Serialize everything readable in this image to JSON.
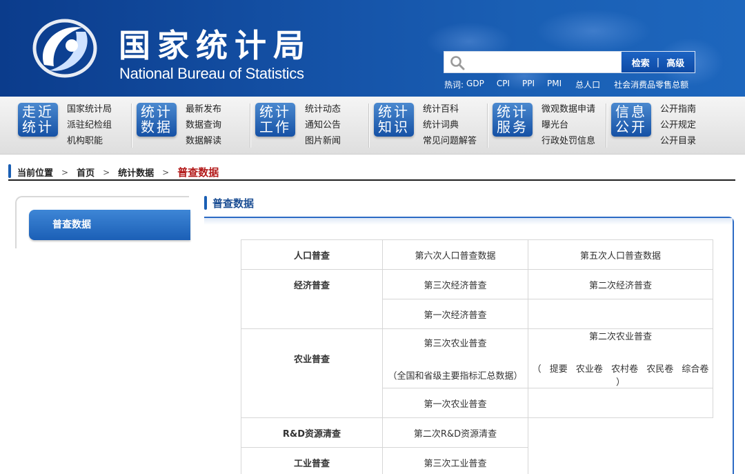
{
  "header": {
    "logo_cn": "国家统计局",
    "logo_en": "National Bureau of Statistics",
    "search_placeholder": "",
    "search_button": "检索",
    "advanced_button": "高级",
    "hotwords_label": "热词:",
    "hotwords": [
      "GDP",
      "CPI",
      "PPI",
      "PMI",
      "总人口",
      "社会消费品零售总额"
    ]
  },
  "nav": [
    {
      "badge": [
        "走近",
        "统计"
      ],
      "links": [
        "国家统计局",
        "派驻纪检组",
        "机构职能"
      ]
    },
    {
      "badge": [
        "统计",
        "数据"
      ],
      "links": [
        "最新发布",
        "数据查询",
        "数据解读"
      ]
    },
    {
      "badge": [
        "统计",
        "工作"
      ],
      "links": [
        "统计动态",
        "通知公告",
        "图片新闻"
      ]
    },
    {
      "badge": [
        "统计",
        "知识"
      ],
      "links": [
        "统计百科",
        "统计词典",
        "常见问题解答"
      ]
    },
    {
      "badge": [
        "统计",
        "服务"
      ],
      "links": [
        "微观数据申请",
        "曝光台",
        "行政处罚信息"
      ]
    },
    {
      "badge": [
        "信息",
        "公开"
      ],
      "links": [
        "公开指南",
        "公开规定",
        "公开目录"
      ]
    }
  ],
  "breadcrumb": {
    "label": "当前位置",
    "items": [
      "首页",
      "统计数据"
    ],
    "current": "普查数据"
  },
  "sidebar": {
    "items": [
      "普查数据"
    ]
  },
  "content": {
    "title": "普查数据",
    "table": {
      "population": {
        "category": "人口普查",
        "c1": "第六次人口普查数据",
        "c2": "第五次人口普查数据"
      },
      "economic": {
        "category": "经济普查",
        "r1c1": "第三次经济普查",
        "r1c2": "第二次经济普查",
        "r2c1": "第一次经济普查"
      },
      "agriculture": {
        "category": "农业普查",
        "c1_title": "第三次农业普查",
        "c1_sub": "（全国和省级主要指标汇总数据）",
        "c2_title": "第二次农业普查",
        "c2_open": "（",
        "c2_links": [
          "提要",
          "农业卷",
          "农村卷",
          "农民卷",
          "综合卷"
        ],
        "c2_close": "）",
        "r2c1": "第一次农业普查"
      },
      "rd": {
        "category": "R&D资源清查",
        "c1": "第二次R&D资源清查"
      },
      "industry": {
        "category": "工业普查",
        "c1": "第三次工业普查"
      }
    }
  }
}
